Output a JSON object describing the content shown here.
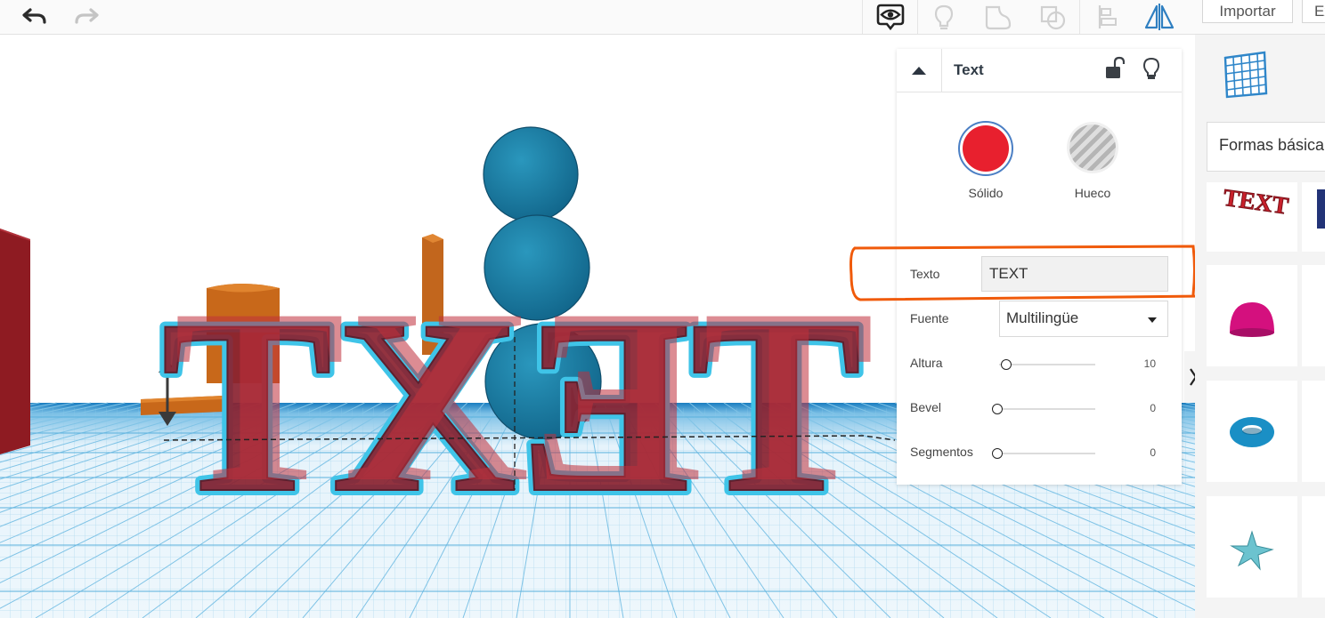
{
  "toolbar": {
    "import_label": "Importar",
    "export_label": "Ex"
  },
  "inspector": {
    "title": "Text",
    "solid_label": "Sólido",
    "hole_label": "Hueco",
    "solid_color": "#e8202e",
    "props": {
      "texto_label": "Texto",
      "texto_value": "TEXT",
      "fuente_label": "Fuente",
      "fuente_value": "Multilingüe",
      "altura_label": "Altura",
      "altura_value": "10",
      "bevel_label": "Bevel",
      "bevel_value": "0",
      "segmentos_label": "Segmentos",
      "segmentos_value": "0"
    }
  },
  "shapes_panel": {
    "category_label": "Formas básica",
    "items": [
      "text-shape",
      "half-sphere-shape",
      "torus-shape",
      "star-shape"
    ]
  },
  "scene": {
    "object_text": "TEXT",
    "object_color": "#8b1f2b",
    "selection_color": "#3fc4e8",
    "sphere_color": "#1b7fa3",
    "highlight_color": "#f05a0a"
  },
  "colors": {
    "accent_blue": "#2f7fc1",
    "grid_blue": "#3a9ad0"
  }
}
